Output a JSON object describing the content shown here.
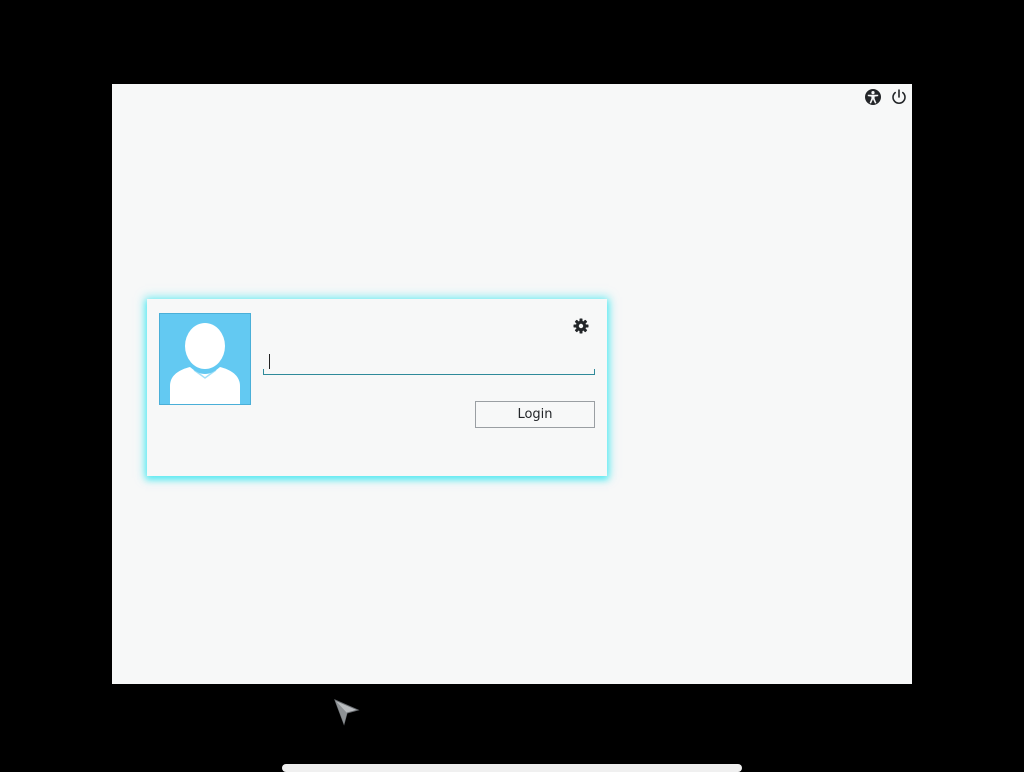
{
  "screen": {
    "background_color": "#F7F8F8",
    "top_right_icons": [
      {
        "name": "accessibility-icon"
      },
      {
        "name": "power-icon"
      }
    ]
  },
  "login_card": {
    "avatar": {
      "background_color": "#63C9F2",
      "icon": "user-silhouette-icon"
    },
    "settings_icon": "gear-icon",
    "password_field": {
      "value": "",
      "placeholder": ""
    },
    "login_button": {
      "label": "Login"
    },
    "glow_color": "#28E6F0"
  },
  "pointer": {
    "icon": "mouse-pointer-icon"
  }
}
